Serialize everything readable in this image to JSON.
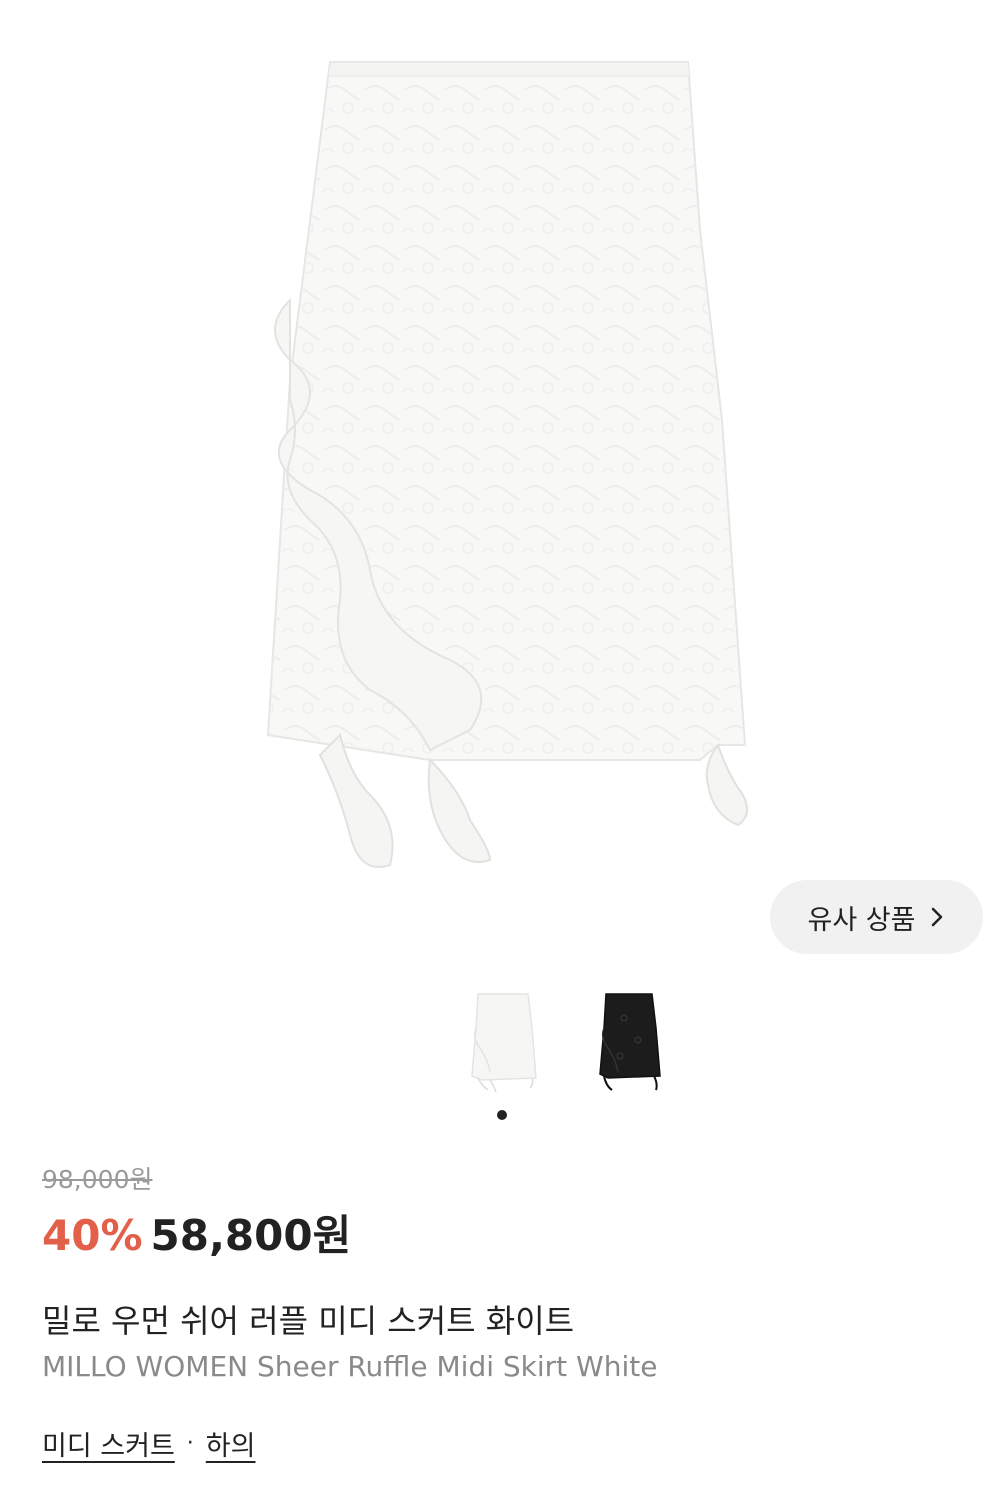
{
  "product": {
    "similar_button_label": "유사 상품",
    "original_price": "98,000원",
    "discount": "40%",
    "sale_price": "58,800원",
    "name_ko": "밀로 우먼 쉬어 러플 미디 스커트 화이트",
    "name_en": "MILLO WOMEN Sheer Ruffle Midi Skirt White",
    "categories": [
      "미디 스커트",
      "하의"
    ],
    "category_separator": "·"
  },
  "thumbnails": [
    {
      "color_name": "white",
      "selected": true
    },
    {
      "color_name": "black",
      "selected": false
    }
  ],
  "carousel": {
    "total": 1,
    "active": 1
  },
  "colors": {
    "discount": "#e2604a",
    "text": "#222222",
    "muted": "#8a8a8a",
    "pill_bg": "#f1f1f1"
  }
}
